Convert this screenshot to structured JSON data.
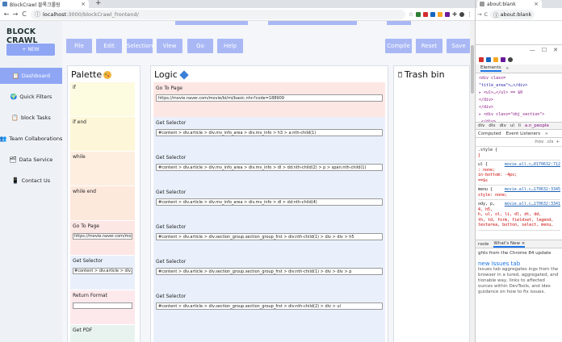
{
  "browser": {
    "tab_title": "BlockCrawl 블록크롤링",
    "tab_close": "×",
    "new_tab": "+",
    "url_host": "localhost",
    "url_path": ":3000/blockCrawl_frontend/",
    "info_icon": "ⓘ",
    "nav_back": "←",
    "nav_forward": "→",
    "nav_reload": "C"
  },
  "sidebar": {
    "brand": "BLOCK CRAWL",
    "new_label": "+ NEW",
    "items": [
      {
        "label": "Dashboard",
        "icon": "📋"
      },
      {
        "label": "Quick Filters",
        "icon": "🌍"
      },
      {
        "label": "block Tasks",
        "icon": "📋"
      },
      {
        "label": "Team Collaborations",
        "icon": "👥"
      },
      {
        "label": "Data Service",
        "icon": "🗂"
      },
      {
        "label": "Contact Us",
        "icon": "📱"
      }
    ]
  },
  "toolbar": {
    "left": [
      "File",
      "Edit",
      "Selection",
      "View",
      "Go",
      "Help"
    ],
    "right": [
      "Compile",
      "Reset",
      "Save"
    ]
  },
  "palette": {
    "title": "Palette",
    "blocks": [
      {
        "label": "if",
        "color": "#fdfbe0",
        "input": null
      },
      {
        "label": "if end",
        "color": "#fdf6d8",
        "input": null
      },
      {
        "label": "while",
        "color": "#fdeee0",
        "input": null
      },
      {
        "label": "while end",
        "color": "#fde8dc",
        "input": null
      },
      {
        "label": "Go To Page",
        "color": "#fde7e5",
        "input": "https://movie.naver.com/movie"
      },
      {
        "label": "Get Selector",
        "color": "#eaf0fb",
        "input": "#content > div.article > div.mv"
      },
      {
        "label": "Return Format",
        "color": "#fde9ec",
        "input": ""
      },
      {
        "label": "Get PDF",
        "color": "#e8f3ef",
        "input": null
      }
    ]
  },
  "logic": {
    "title": "Logic",
    "blocks": [
      {
        "label": "Go To Page",
        "color": "#fde7e5",
        "value": "https://movie.naver.com/movie/bi/mi/basic.nhn?code=188909"
      },
      {
        "label": "Get Selector",
        "color": "#eaf0fb",
        "value": "#content > div.article > div.mv_info_area > div.mv_info > h3 > a:nth-child(1)"
      },
      {
        "label": "Get Selector",
        "color": "#eaf0fb",
        "value": "#content > div.article > div.mv_info_area > div.mv_info > dl > dd:nth-child(2) > p > span:nth-child(1)"
      },
      {
        "label": "Get Selector",
        "color": "#eaf0fb",
        "value": "#content > div.article > div.mv_info_area > div.mv_info > dl > dd:nth-child(4)"
      },
      {
        "label": "Get Selector",
        "color": "#eaf0fb",
        "value": "#content > div.article > div.section_group.section_group_frst > div:nth-child(1) > div > div > h5"
      },
      {
        "label": "Get Selector",
        "color": "#eaf0fb",
        "value": "#content > div.article > div.section_group.section_group_frst > div:nth-child(1) > div > div > p"
      },
      {
        "label": "Get Selector",
        "color": "#eaf0fb",
        "value": "#content > div.article > div.section_group.section_group_frst > div:nth-child(2) > div > ul"
      },
      {
        "label": "",
        "color": "#eaf0fb",
        "value": null
      }
    ]
  },
  "trash": {
    "title": "Trash bin"
  },
  "colors": {
    "accent": "#8fa6f5",
    "button": "#a9b8f5",
    "sidebar_bg": "#eef2f7"
  },
  "second_window": {
    "tab_title": "about:blank",
    "url": "about:blank",
    "devtools": {
      "win_controls": [
        "—",
        "☐",
        "✕"
      ],
      "tabs": [
        "Elements",
        "»"
      ],
      "code_lines": [
        {
          "t": "<div class=",
          "c": "tag"
        },
        {
          "t": "\"title_area\">…</div>",
          "c": "val"
        },
        {
          "t": "▸ <ul>…</ul> == $0",
          "c": "tag"
        },
        {
          "t": "</div>",
          "c": "tag"
        },
        {
          "t": "</div>",
          "c": "tag"
        },
        {
          "t": "▸ <div class=\"obj_section\">",
          "c": "tag"
        },
        {
          "t": "…</div>",
          "c": "tag"
        }
      ],
      "crumbs": [
        "div",
        "div",
        "div",
        "ul",
        "li",
        "a.n_people"
      ],
      "subtabs": [
        "Computed",
        "Event Listeners",
        "»"
      ],
      "filter": [
        ":hov",
        ".cls",
        "+"
      ],
      "rules": [
        {
          "sel": ".style {",
          "src": "",
          "lines": [
            "}"
          ]
        },
        {
          "sel": "ul {",
          "src": "movie.all.c…0170632:712",
          "lines": [
            ": none;",
            "in-bottom: -4px;",
            "==$s"
          ]
        },
        {
          "sel": "menu {",
          "src": "movie.all.c…170632:3345",
          "lines": [
            "style: none;"
          ]
        },
        {
          "sel": "ody, p,",
          "src": "movie.all.c…170632:3341",
          "lines": [
            "4, h5,",
            "h, ul, ol, li, dl, dt, dd,",
            "th, td, form, fieldset, legend,",
            "textarea, button, select, menu,"
          ]
        }
      ],
      "drawer_tabs": [
        "rsole",
        "What's New ×"
      ],
      "whatsnew_intro": "ghts from the Chrome 84 update",
      "whatsnew_head": "new Issues tab",
      "whatsnew_body": "Issues tab aggregates ings from the browser in a tured, aggregated, and tionable way, links to affected ources within DevTools, and ides guidance on how to fix issues."
    }
  }
}
